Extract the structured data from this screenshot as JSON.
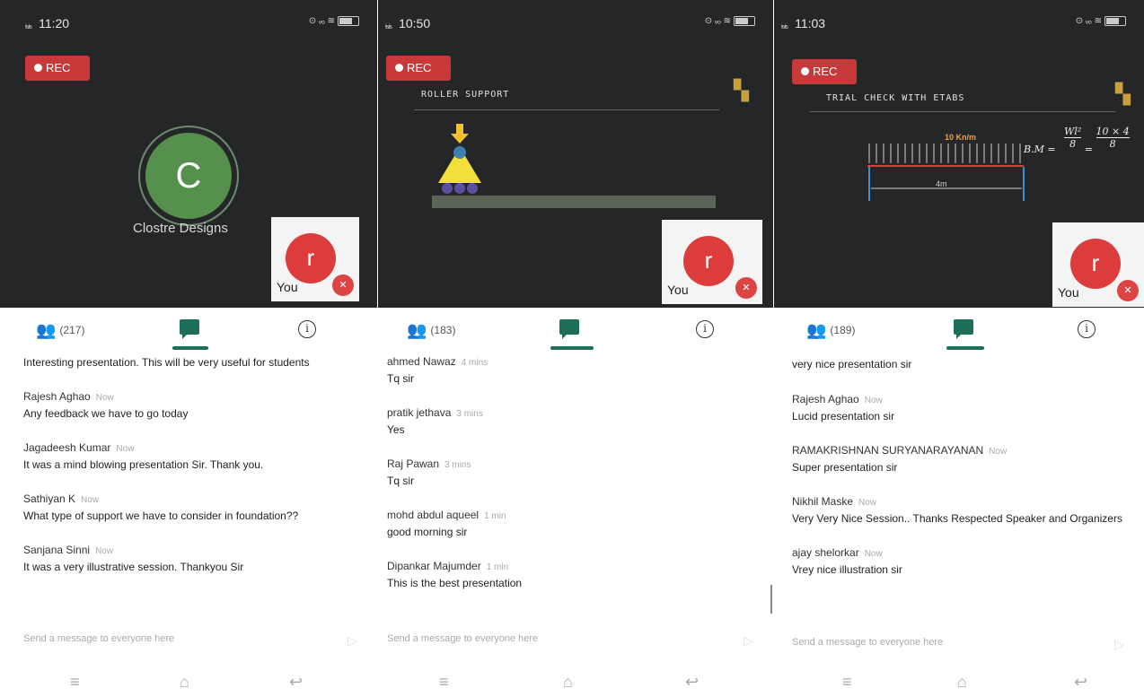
{
  "panels": [
    {
      "status": {
        "signal": "ᵢ₅ᵢ₅",
        "time": "11:20",
        "right": "⊙ ᵥₒ ≋"
      },
      "rec_label": "REC",
      "host": {
        "initial": "C",
        "name": "Clostre Designs"
      },
      "self": {
        "initial": "r",
        "label": "You"
      },
      "participants_count": "(217)",
      "messages": [
        {
          "name": "",
          "time": "",
          "text": "Interesting presentation. This will be very useful for students"
        },
        {
          "name": "Rajesh Aghao",
          "time": "Now",
          "text": "Any feedback we have to go today"
        },
        {
          "name": "Jagadeesh Kumar",
          "time": "Now",
          "text": "It was a mind blowing presentation Sir. Thank you."
        },
        {
          "name": "Sathiyan K",
          "time": "Now",
          "text": "What type of support we have to consider in foundation??"
        },
        {
          "name": "Sanjana Sinni",
          "time": "Now",
          "text": "It was a very illustrative session. Thankyou Sir"
        }
      ],
      "composer_placeholder": "Send a message to everyone here"
    },
    {
      "status": {
        "signal": "ᵢ₅ᵢ₅",
        "time": "10:50",
        "right": "⊙ ᵥₒ ≋"
      },
      "rec_label": "REC",
      "board_title": "ROLLER SUPPORT",
      "self": {
        "initial": "r",
        "label": "You"
      },
      "participants_count": "(183)",
      "messages": [
        {
          "name": "ahmed Nawaz",
          "time": "4 mins",
          "text": "Tq sir"
        },
        {
          "name": "pratik jethava",
          "time": "3 mins",
          "text": "Yes"
        },
        {
          "name": "Raj Pawan",
          "time": "3 mins",
          "text": "Tq sir"
        },
        {
          "name": "mohd abdul aqueel",
          "time": "1 min",
          "text": "good morning sir"
        },
        {
          "name": "Dipankar Majumder",
          "time": "1 min",
          "text": "This is the best presentation"
        }
      ],
      "composer_placeholder": "Send a message to everyone here"
    },
    {
      "status": {
        "signal": "ᵢ₅ᵢ₅",
        "time": "11:03",
        "right": "⊙ ᵥₒ ≋"
      },
      "rec_label": "REC",
      "board_title": "TRIAL CHECK WITH ETABS",
      "board_load": "10 Kn/m",
      "board_span": "4m",
      "board_formula_lhs": "B.M =",
      "board_formula_num": "Wl²",
      "board_formula_den": "8",
      "board_formula_num2": "10 × 4",
      "board_formula_den2": "8",
      "self": {
        "initial": "r",
        "label": "You"
      },
      "participants_count": "(189)",
      "messages": [
        {
          "name": "",
          "time": "",
          "text": "very nice presentation sir"
        },
        {
          "name": "Rajesh Aghao",
          "time": "Now",
          "text": "Lucid presentation sir"
        },
        {
          "name": "RAMAKRISHNAN SURYANARAYANAN",
          "time": "Now",
          "text": "Super presentation sir"
        },
        {
          "name": "Nikhil Maske",
          "time": "Now",
          "text": "Very Very Nice Session.. Thanks Respected Speaker and Organizers"
        },
        {
          "name": "ajay shelorkar",
          "time": "Now",
          "text": "Vrey nice illustration sir"
        }
      ],
      "composer_placeholder": "Send a message to everyone here"
    }
  ]
}
